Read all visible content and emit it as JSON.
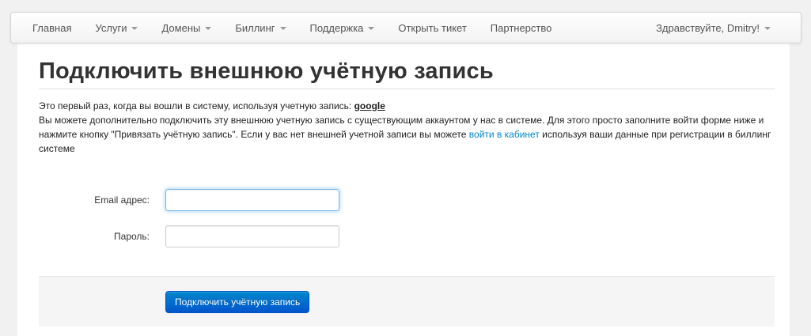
{
  "navbar": {
    "items": [
      {
        "label": "Главная"
      },
      {
        "label": "Услуги"
      },
      {
        "label": "Домены"
      },
      {
        "label": "Биллинг"
      },
      {
        "label": "Поддержка"
      },
      {
        "label": "Открыть тикет"
      },
      {
        "label": "Партнерство"
      }
    ],
    "user_menu": {
      "label": "Здравствуйте, Dmitry!"
    }
  },
  "page": {
    "title": "Подключить внешнюю учётную запись",
    "intro_prefix": "Это первый раз, когда вы вошли в систему, используя учетную запись: ",
    "provider": "google",
    "desc_prefix": "Вы можете дополнительно подключить эту внешнюю учетную запись с существующим аккаунтом у нас в системе. Для этого просто заполните войти форме ниже и нажмите кнопку \"Привязать учётную запись\". Если у вас нет внешней учетной записи вы можете ",
    "login_link": "войти в кабинет",
    "desc_suffix": " используя ваши данные при регистрации в биллинг системе"
  },
  "form": {
    "email_label": "Email адрес:",
    "email_value": "",
    "password_label": "Пароль:",
    "password_value": "",
    "submit_label": "Подключить учётную запись"
  }
}
